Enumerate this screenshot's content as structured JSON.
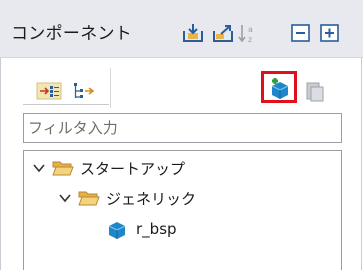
{
  "view": {
    "title": "コンポーネント"
  },
  "toolbar": {
    "icons": [
      "import-icon",
      "export-icon",
      "sort-icon",
      "collapse-all-icon",
      "expand-all-icon"
    ]
  },
  "panel_toolbar": {
    "view_icons": [
      "component-view-icon",
      "hierarchy-view-icon"
    ],
    "action_icons": [
      "add-component-icon",
      "remove-component-icon"
    ],
    "highlight_color": "#e0101d"
  },
  "filter": {
    "placeholder": "フィルタ入力",
    "value": ""
  },
  "tree": {
    "nodes": [
      {
        "label": "スタートアップ",
        "icon": "folder-icon",
        "expanded": true,
        "level": 0
      },
      {
        "label": "ジェネリック",
        "icon": "folder-icon",
        "expanded": true,
        "level": 1
      },
      {
        "label": "r_bsp",
        "icon": "component-cube-icon",
        "level": 2
      }
    ]
  }
}
